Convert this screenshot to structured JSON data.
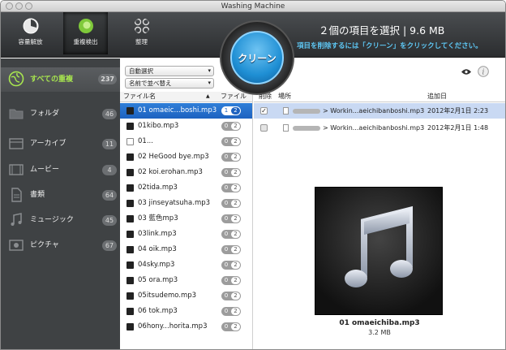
{
  "window": {
    "title": "Washing Machine"
  },
  "toolbar": {
    "buttons": [
      {
        "label": "容量解放",
        "icon": "clock-icon"
      },
      {
        "label": "重複検出",
        "icon": "duplicate-icon"
      },
      {
        "label": "整理",
        "icon": "organize-icon"
      }
    ],
    "clean_label": "クリーン",
    "selection_title": "２個の項目を選択 | 9.6 MB",
    "hint": "項目を削除するには「クリーン」をクリックしてください。"
  },
  "sidebar": {
    "items": [
      {
        "label": "すべての重複",
        "count": "237",
        "icon": "globe-icon"
      },
      {
        "label": "フォルダ",
        "count": "46",
        "icon": "folder-icon"
      },
      {
        "label": "アーカイブ",
        "count": "11",
        "icon": "archive-icon"
      },
      {
        "label": "ムービー",
        "count": "4",
        "icon": "film-icon"
      },
      {
        "label": "書類",
        "count": "64",
        "icon": "document-icon"
      },
      {
        "label": "ミュージック",
        "count": "45",
        "icon": "music-icon"
      },
      {
        "label": "ピクチャ",
        "count": "67",
        "icon": "picture-icon"
      }
    ]
  },
  "filepanel": {
    "select_label": "自動選択",
    "sort_label": "名前で並べ替え",
    "col_name": "ファイル名",
    "col_files": "ファイル",
    "files": [
      {
        "name": "01 omaeic...boshi.mp3",
        "a": "1",
        "b": "2"
      },
      {
        "name": "01kibo.mp3",
        "a": "0",
        "b": "2"
      },
      {
        "name": "01...",
        "a": "0",
        "b": "2"
      },
      {
        "name": "02 HeGood bye.mp3",
        "a": "0",
        "b": "2"
      },
      {
        "name": "02 koi.erohan.mp3",
        "a": "0",
        "b": "2"
      },
      {
        "name": "02tida.mp3",
        "a": "0",
        "b": "2"
      },
      {
        "name": "03 jinseyatsuha.mp3",
        "a": "0",
        "b": "2"
      },
      {
        "name": "03 藍色mp3",
        "a": "0",
        "b": "2"
      },
      {
        "name": "03link.mp3",
        "a": "0",
        "b": "2"
      },
      {
        "name": "04 oik.mp3",
        "a": "0",
        "b": "2"
      },
      {
        "name": "04sky.mp3",
        "a": "0",
        "b": "2"
      },
      {
        "name": "05 ora.mp3",
        "a": "0",
        "b": "2"
      },
      {
        "name": "05itsudemo.mp3",
        "a": "0",
        "b": "2"
      },
      {
        "name": "06 tok.mp3",
        "a": "0",
        "b": "2"
      },
      {
        "name": "06hony...horita.mp3",
        "a": "0",
        "b": "2"
      }
    ]
  },
  "detail": {
    "col_delete": "削除",
    "col_location": "場所",
    "col_added": "追加日",
    "rows": [
      {
        "checked": true,
        "path": "> Workin...aeichibanboshi.mp3",
        "date": "2012年2月1日 2:23"
      },
      {
        "checked": false,
        "path": "> Workin...aeichibanboshi.mp3",
        "date": "2012年2月1日 1:48"
      }
    ],
    "preview_name": "01 omaeichiba.mp3",
    "preview_size": "3.2 MB"
  }
}
